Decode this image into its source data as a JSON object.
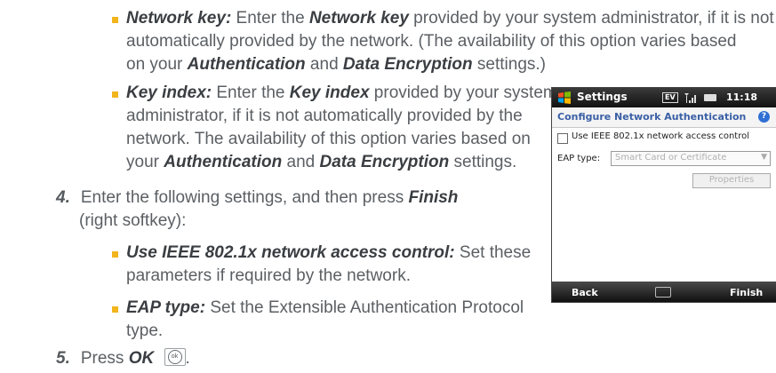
{
  "items": [
    {
      "term": "Network key:",
      "t1": " Enter the ",
      "em": "Network key",
      "t2": " provided by your system administrator, if it is not",
      "line2": "automatically provided by the network. (The availability of this option varies based",
      "line3a": "on your ",
      "auth": "Authentication",
      "and": " and ",
      "enc": "Data Encryption",
      "line3b": " settings.)"
    },
    {
      "term": "Key index:",
      "t1": " Enter the ",
      "em": "Key index",
      "t2": " provided by your system",
      "line2": "administrator, if it is not automatically provided by the",
      "line3": "network. The availability of this option varies based on",
      "line4a": "your ",
      "auth": "Authentication",
      "and": " and ",
      "enc": "Data Encryption",
      "line4b": " settings."
    }
  ],
  "step4": {
    "num": "4.",
    "t1": "Enter the following settings, and then press ",
    "finish": "Finish",
    "line2": "(right softkey):"
  },
  "sub": [
    {
      "term": "Use IEEE 802.1x network access control:",
      "t1": " Set these",
      "line2": "parameters if required by the network."
    },
    {
      "term": "EAP type:",
      "t1": " Set the Extensible Authentication Protocol",
      "line2": "type."
    }
  ],
  "step5": {
    "num": "5.",
    "t1": "Press ",
    "ok": "OK",
    "key": "ok"
  },
  "phone": {
    "app_title": "Settings",
    "ev": "EV",
    "time": "11:18",
    "header": "Configure Network Authentication",
    "help": "?",
    "checkbox_label": "Use IEEE 802.1x network access control",
    "eap_label": "EAP type:",
    "eap_value": "Smart Card or Certificate",
    "properties": "Properties",
    "back": "Back",
    "finish": "Finish"
  }
}
